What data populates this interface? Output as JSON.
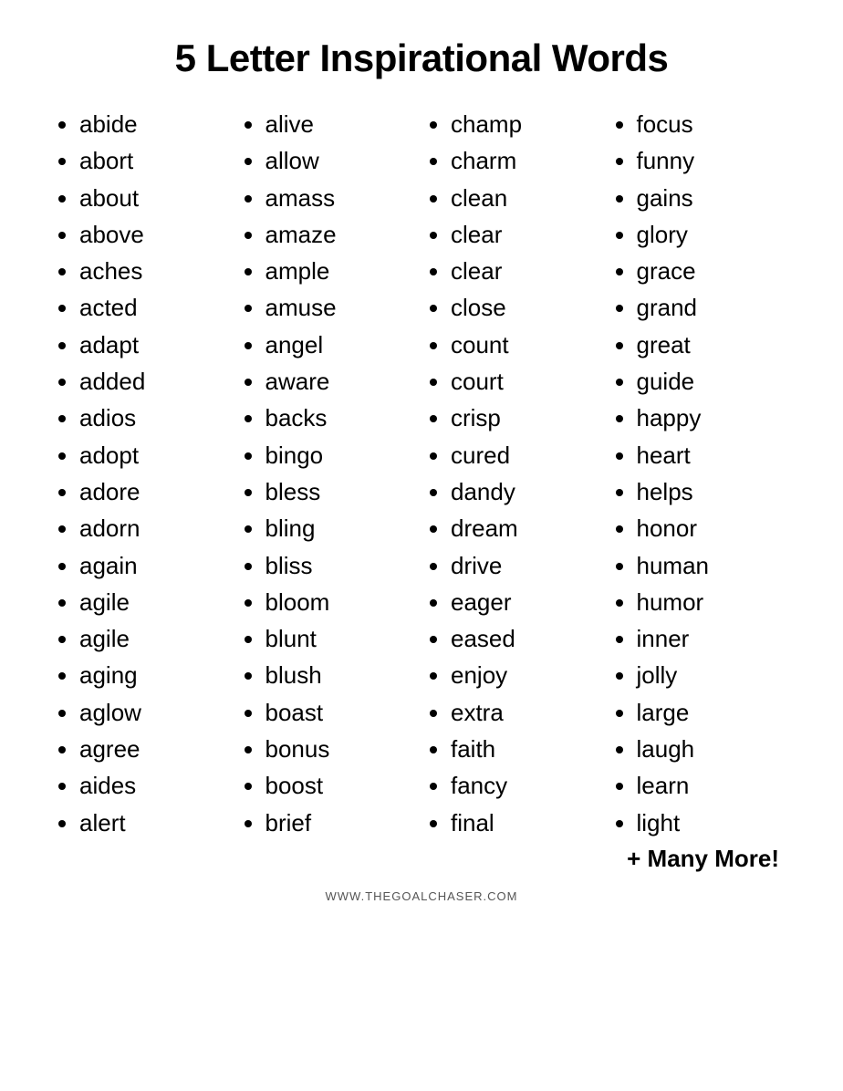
{
  "title": "5 Letter Inspirational Words",
  "columns": [
    {
      "id": "col1",
      "words": [
        "abide",
        "abort",
        "about",
        "above",
        "aches",
        "acted",
        "adapt",
        "added",
        "adios",
        "adopt",
        "adore",
        "adorn",
        "again",
        "agile",
        "agile",
        "aging",
        "aglow",
        "agree",
        "aides",
        "alert"
      ]
    },
    {
      "id": "col2",
      "words": [
        "alive",
        "allow",
        "amass",
        "amaze",
        "ample",
        "amuse",
        "angel",
        "aware",
        "backs",
        "bingo",
        "bless",
        "bling",
        "bliss",
        "bloom",
        "blunt",
        "blush",
        "boast",
        "bonus",
        "boost",
        "brief"
      ]
    },
    {
      "id": "col3",
      "words": [
        "champ",
        "charm",
        "clean",
        "clear",
        "clear",
        "close",
        "count",
        "court",
        "crisp",
        "cured",
        "dandy",
        "dream",
        "drive",
        "eager",
        "eased",
        "enjoy",
        "extra",
        "faith",
        "fancy",
        "final"
      ]
    },
    {
      "id": "col4",
      "words": [
        "focus",
        "funny",
        "gains",
        "glory",
        "grace",
        "grand",
        "great",
        "guide",
        "happy",
        "heart",
        "helps",
        "honor",
        "human",
        "humor",
        "inner",
        "jolly",
        "large",
        "laugh",
        "learn",
        "light"
      ]
    }
  ],
  "more_label": "+ Many More!",
  "footer": "WWW.THEGOALCHASER.COM"
}
